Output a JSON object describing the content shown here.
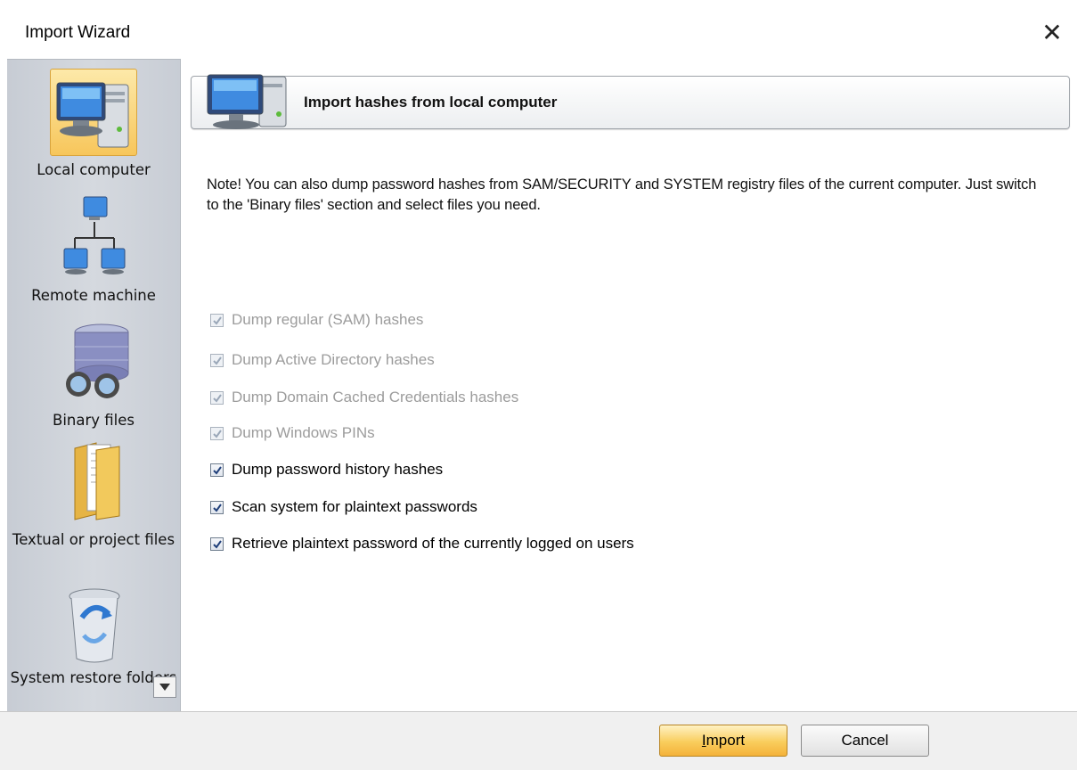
{
  "window": {
    "title": "Import Wizard",
    "close_glyph": "✕"
  },
  "sidebar": {
    "items": [
      {
        "label": "Local computer",
        "icon": "computer-icon",
        "selected": true
      },
      {
        "label": "Remote machine",
        "icon": "network-icon",
        "selected": false
      },
      {
        "label": "Binary files",
        "icon": "database-binoculars-icon",
        "selected": false
      },
      {
        "label": "Textual or project files",
        "icon": "folder-icon",
        "selected": false
      },
      {
        "label": "System restore folders",
        "icon": "recycle-bin-icon",
        "selected": false
      }
    ]
  },
  "header": {
    "title": "Import hashes from local computer",
    "icon": "computer-icon"
  },
  "note": "Note! You can also dump password hashes from SAM/SECURITY and SYSTEM registry files of the current computer. Just switch to the 'Binary files' section and select files you need.",
  "options": [
    {
      "label": "Dump regular (SAM) hashes",
      "checked": true,
      "enabled": false
    },
    {
      "label": "Dump Active Directory hashes",
      "checked": true,
      "enabled": false
    },
    {
      "label": "Dump Domain Cached Credentials hashes",
      "checked": true,
      "enabled": false
    },
    {
      "label": "Dump Windows PINs",
      "checked": true,
      "enabled": false
    },
    {
      "label": "Dump password history hashes",
      "checked": true,
      "enabled": true
    },
    {
      "label": "Scan system for plaintext passwords",
      "checked": true,
      "enabled": true
    },
    {
      "label": "Retrieve plaintext password of the currently logged on users",
      "checked": true,
      "enabled": true
    }
  ],
  "buttons": {
    "import_access": "I",
    "import_rest": "mport",
    "cancel": "Cancel"
  },
  "colors": {
    "selected_bg": "#f7c65b",
    "import_button": "#f9cd5c",
    "sidebar_bg": "#d0d4db"
  }
}
